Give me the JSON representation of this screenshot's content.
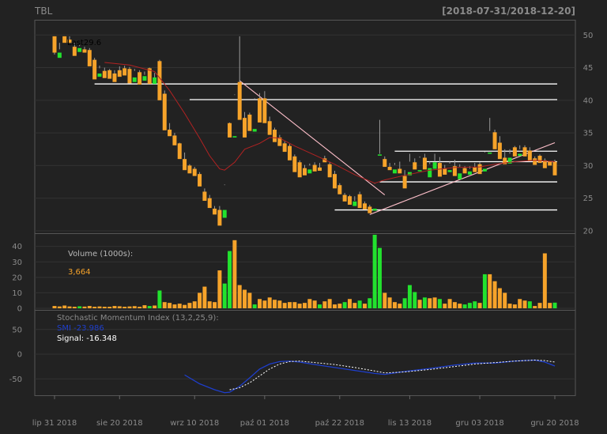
{
  "chart_data": {
    "type": "candlestick",
    "title": "TBL",
    "date_range": "[2018-07-31/2018-12-20]",
    "x_tick_labels": [
      "lip 31 2018",
      "sie 20 2018",
      "wrz 10 2018",
      "paź 01 2018",
      "paź 22 2018",
      "lis 13 2018",
      "gru 03 2018",
      "gru 20 2018"
    ],
    "price_ticks": [
      20,
      25,
      30,
      35,
      40,
      45,
      50
    ],
    "price_ylim": [
      20,
      51
    ],
    "last_label": "Last",
    "last_value": "29.6",
    "candles": [
      [
        49.8,
        49.8,
        47.3,
        47.0,
        "o"
      ],
      [
        47.3,
        48.8,
        46.5,
        47.8,
        "g"
      ],
      [
        49.8,
        49.8,
        48.8,
        49.3,
        "o"
      ],
      [
        49.3,
        49.8,
        48.8,
        49.3,
        "o"
      ],
      [
        48.2,
        48.8,
        46.8,
        47.5,
        "o"
      ],
      [
        48.0,
        48.5,
        47.4,
        48.3,
        "g"
      ],
      [
        47.8,
        48.2,
        47.3,
        47.3,
        "o"
      ],
      [
        47.7,
        48.0,
        45.2,
        45.6,
        "o"
      ],
      [
        46.2,
        46.5,
        43.2,
        44.0,
        "o"
      ],
      [
        44.1,
        45.3,
        43.6,
        44.9,
        "g"
      ],
      [
        44.5,
        45.0,
        43.4,
        43.6,
        "o"
      ],
      [
        44.6,
        44.8,
        43.3,
        43.6,
        "o"
      ],
      [
        44.1,
        44.6,
        42.8,
        43.4,
        "o"
      ],
      [
        44.6,
        45.2,
        43.6,
        44.3,
        "o"
      ],
      [
        44.9,
        45.3,
        43.8,
        44.1,
        "o"
      ],
      [
        44.8,
        45.1,
        42.6,
        43.3,
        "o"
      ],
      [
        43.5,
        44.8,
        42.8,
        44.5,
        "g"
      ],
      [
        44.3,
        44.6,
        42.4,
        43.1,
        "o"
      ],
      [
        43.7,
        44.4,
        43.0,
        43.9,
        "g"
      ],
      [
        44.9,
        45.0,
        42.5,
        42.9,
        "o"
      ],
      [
        43.5,
        44.2,
        42.5,
        42.8,
        "g"
      ],
      [
        46.0,
        46.2,
        40.0,
        42.2,
        "o"
      ],
      [
        41.0,
        41.5,
        35.4,
        36.3,
        "o"
      ],
      [
        35.5,
        36.5,
        34.5,
        35.0,
        "o"
      ],
      [
        34.6,
        35.0,
        33.1,
        33.3,
        "o"
      ],
      [
        33.4,
        33.5,
        31.0,
        31.5,
        "o"
      ],
      [
        31.0,
        32.0,
        29.3,
        29.6,
        "o"
      ],
      [
        30.0,
        30.2,
        28.8,
        29.1,
        "o"
      ],
      [
        29.5,
        29.8,
        28.4,
        28.8,
        "o"
      ],
      [
        28.7,
        29.0,
        26.8,
        27.2,
        "o"
      ],
      [
        26.0,
        26.5,
        24.6,
        25.0,
        "o"
      ],
      [
        25.0,
        25.5,
        23.5,
        23.8,
        "o"
      ],
      [
        23.4,
        23.8,
        22.5,
        22.8,
        "o"
      ],
      [
        23.2,
        23.8,
        20.8,
        21.3,
        "o"
      ],
      [
        23.2,
        27.1,
        22.0,
        27.0,
        "g"
      ],
      [
        36.5,
        36.6,
        34.3,
        34.4,
        "o"
      ],
      [
        34.5,
        40.9,
        34.3,
        40.8,
        "g"
      ],
      [
        42.8,
        49.8,
        37.0,
        37.3,
        "o"
      ],
      [
        37.3,
        38.2,
        34.3,
        34.6,
        "o"
      ],
      [
        37.8,
        38.1,
        35.3,
        35.6,
        "o"
      ],
      [
        35.6,
        40.3,
        35.2,
        40.2,
        "g"
      ],
      [
        40.3,
        41.1,
        36.6,
        36.8,
        "o"
      ],
      [
        40.3,
        41.4,
        36.5,
        36.8,
        "o"
      ],
      [
        36.8,
        37.5,
        34.7,
        35.1,
        "o"
      ],
      [
        35.5,
        35.8,
        33.6,
        33.9,
        "o"
      ],
      [
        34.3,
        34.7,
        33.0,
        33.4,
        "o"
      ],
      [
        33.4,
        33.7,
        32.1,
        32.6,
        "o"
      ],
      [
        33.0,
        33.3,
        30.8,
        31.5,
        "o"
      ],
      [
        31.4,
        31.7,
        29.0,
        29.3,
        "o"
      ],
      [
        30.5,
        30.8,
        28.2,
        28.6,
        "o"
      ],
      [
        29.6,
        30.1,
        28.5,
        29.0,
        "o"
      ],
      [
        29.4,
        30.3,
        28.8,
        30.0,
        "g"
      ],
      [
        30.1,
        30.5,
        29.1,
        29.5,
        "o"
      ],
      [
        29.7,
        30.4,
        29.2,
        29.6,
        "o"
      ],
      [
        31.1,
        31.5,
        30.5,
        30.6,
        "o"
      ],
      [
        30.2,
        30.6,
        28.2,
        28.7,
        "o"
      ],
      [
        28.7,
        29.2,
        26.5,
        27.0,
        "o"
      ],
      [
        27.0,
        27.3,
        25.6,
        26.0,
        "o"
      ],
      [
        25.5,
        25.8,
        24.5,
        24.8,
        "o"
      ],
      [
        25.3,
        25.5,
        24.0,
        24.3,
        "o"
      ],
      [
        24.5,
        25.3,
        23.8,
        24.6,
        "g"
      ],
      [
        25.6,
        26.0,
        23.5,
        24.0,
        "o"
      ],
      [
        24.2,
        24.5,
        23.3,
        23.6,
        "o"
      ],
      [
        23.7,
        24.0,
        22.7,
        23.1,
        "o"
      ],
      [
        23.4,
        27.3,
        23.1,
        27.2,
        "g"
      ],
      [
        31.7,
        37.0,
        31.6,
        31.8,
        "g"
      ],
      [
        31.0,
        31.4,
        29.8,
        30.0,
        "o"
      ],
      [
        29.8,
        30.4,
        29.3,
        29.6,
        "o"
      ],
      [
        29.4,
        30.4,
        28.8,
        30.1,
        "g"
      ],
      [
        29.5,
        30.6,
        28.8,
        28.9,
        "o"
      ],
      [
        28.4,
        29.3,
        26.5,
        27.6,
        "o"
      ],
      [
        29.0,
        31.8,
        28.5,
        30.6,
        "g"
      ],
      [
        30.5,
        31.1,
        29.4,
        29.5,
        "o"
      ],
      [
        29.3,
        31.4,
        29.1,
        31.2,
        "g"
      ],
      [
        31.2,
        31.8,
        29.4,
        29.6,
        "o"
      ],
      [
        29.6,
        30.6,
        28.2,
        30.2,
        "g"
      ],
      [
        30.5,
        31.8,
        29.5,
        30.6,
        "g"
      ],
      [
        30.4,
        31.3,
        28.3,
        29.2,
        "o"
      ],
      [
        29.5,
        30.1,
        28.6,
        29.4,
        "o"
      ],
      [
        29.3,
        30.6,
        29.0,
        30.3,
        "g"
      ],
      [
        29.9,
        30.9,
        28.4,
        28.8,
        "o"
      ],
      [
        28.8,
        30.2,
        27.9,
        29.8,
        "g"
      ],
      [
        29.6,
        29.9,
        28.8,
        29.1,
        "o"
      ],
      [
        29.1,
        29.9,
        28.6,
        29.5,
        "g"
      ],
      [
        29.7,
        30.4,
        29.0,
        29.8,
        "o"
      ],
      [
        30.2,
        30.5,
        28.7,
        29.4,
        "o"
      ],
      [
        29.5,
        32.1,
        29.1,
        32.0,
        "g"
      ],
      [
        32.0,
        37.3,
        31.8,
        35.3,
        "g"
      ],
      [
        35.1,
        35.5,
        32.5,
        32.8,
        "o"
      ],
      [
        33.5,
        34.5,
        31.0,
        31.2,
        "o"
      ],
      [
        31.2,
        32.5,
        30.2,
        31.0,
        "o"
      ],
      [
        31.2,
        32.5,
        30.3,
        31.8,
        "g"
      ],
      [
        32.8,
        33.0,
        31.4,
        31.8,
        "o"
      ],
      [
        31.8,
        33.1,
        31.5,
        32.5,
        "g"
      ],
      [
        32.8,
        33.1,
        31.4,
        31.6,
        "o"
      ],
      [
        32.3,
        32.8,
        30.7,
        31.1,
        "o"
      ],
      [
        31.1,
        31.4,
        30.1,
        30.2,
        "o"
      ],
      [
        31.5,
        31.7,
        30.4,
        30.7,
        "o"
      ],
      [
        30.8,
        31.1,
        29.6,
        30.1,
        "o"
      ],
      [
        30.6,
        30.7,
        30.0,
        30.2,
        "o"
      ],
      [
        30.6,
        30.9,
        28.5,
        29.6,
        "o"
      ]
    ],
    "sma_line": [
      [
        0,
        null
      ],
      [
        5,
        null
      ],
      [
        10,
        45.8
      ],
      [
        15,
        45.4
      ],
      [
        20,
        44.4
      ],
      [
        23,
        41.5
      ],
      [
        26,
        38.0
      ],
      [
        29,
        34.2
      ],
      [
        31,
        31.5
      ],
      [
        33,
        29.5
      ],
      [
        34,
        29.3
      ],
      [
        36,
        30.5
      ],
      [
        38,
        32.5
      ],
      [
        41,
        33.4
      ],
      [
        43,
        34.3
      ],
      [
        45,
        34.2
      ],
      [
        48,
        33.0
      ],
      [
        52,
        31.6
      ],
      [
        56,
        30.2
      ],
      [
        60,
        28.6
      ],
      [
        64,
        27.3
      ],
      [
        66,
        27.8
      ],
      [
        70,
        28.5
      ],
      [
        75,
        29.3
      ],
      [
        80,
        29.7
      ],
      [
        85,
        29.8
      ],
      [
        88,
        30.2
      ],
      [
        92,
        30.6
      ],
      [
        96,
        30.8
      ],
      [
        100,
        30.6
      ]
    ],
    "horizontal_levels": [
      {
        "y": 42.5,
        "from": 8,
        "to": 100
      },
      {
        "y": 40.1,
        "from": 27,
        "to": 100
      },
      {
        "y": 32.2,
        "from": 68,
        "to": 100
      },
      {
        "y": 30.6,
        "from": 74,
        "to": 100
      },
      {
        "y": 27.5,
        "from": 65,
        "to": 100
      },
      {
        "y": 23.2,
        "from": 56,
        "to": 100
      }
    ],
    "trend_lines": [
      {
        "x1": 37,
        "y1": 43.0,
        "x2": 66,
        "y2": 25.5
      },
      {
        "x1": 63,
        "y1": 22.5,
        "x2": 100,
        "y2": 33.5
      }
    ],
    "volume": {
      "label": "Volume (1000s):",
      "last": "3,664",
      "ticks": [
        0,
        10,
        20,
        30,
        40
      ],
      "ylim": [
        0,
        48
      ],
      "values": [
        1.5,
        1.2,
        1.8,
        1.2,
        1.0,
        1.3,
        1.1,
        1.5,
        1.0,
        1.2,
        1.0,
        1.0,
        1.5,
        1.3,
        1.0,
        1.2,
        1.4,
        1.0,
        2.0,
        1.5,
        1.8,
        11.5,
        4.0,
        3.5,
        2.5,
        3.0,
        2.2,
        3.5,
        4.5,
        10.0,
        14.0,
        4.5,
        4.0,
        24.5,
        16.0,
        37.0,
        44.0,
        15.0,
        12.0,
        10.0,
        2.5,
        6.0,
        5.0,
        7.0,
        5.5,
        5.0,
        3.5,
        4.0,
        4.0,
        3.0,
        3.5,
        6.0,
        5.0,
        2.5,
        4.5,
        6.0,
        2.5,
        3.0,
        4.0,
        6.0,
        3.5,
        5.0,
        3.0,
        6.5,
        47.5,
        39.0,
        10.0,
        7.0,
        4.0,
        3.0,
        6.5,
        15.0,
        10.5,
        5.5,
        7.0,
        6.5,
        7.0,
        6.0,
        3.0,
        6.0,
        4.0,
        3.0,
        2.5,
        3.5,
        4.5,
        3.5,
        22.0,
        22.0,
        17.5,
        13.0,
        10.0,
        3.0,
        2.5,
        6.0,
        5.0,
        4.5,
        1.5,
        3.5,
        35.5,
        3.5,
        3.66
      ],
      "colors": "ooooogooooooooooooogogooooooooooooggoooogoooooooooooogoooogoogogggoooogggogoogoooogggogoooooooogoooog"
    },
    "smi": {
      "label": "Stochastic Momentum Index (13,2,25,9):",
      "smi_label": "SMI",
      "smi_value": "-23.986",
      "signal_label": "Signal:",
      "signal_value": "-16.348",
      "ticks": [
        50,
        0,
        -50
      ],
      "ylim": [
        -88,
        88
      ],
      "smi_points": [
        [
          26,
          -42
        ],
        [
          29,
          -60
        ],
        [
          32,
          -72
        ],
        [
          34,
          -78
        ],
        [
          35,
          -77
        ],
        [
          37,
          -65
        ],
        [
          39,
          -48
        ],
        [
          41,
          -30
        ],
        [
          43,
          -20
        ],
        [
          45,
          -15
        ],
        [
          47,
          -14
        ],
        [
          49,
          -16
        ],
        [
          52,
          -21
        ],
        [
          56,
          -27
        ],
        [
          60,
          -33
        ],
        [
          64,
          -39
        ],
        [
          66,
          -41
        ],
        [
          70,
          -35
        ],
        [
          75,
          -29
        ],
        [
          80,
          -22
        ],
        [
          84,
          -18
        ],
        [
          88,
          -18
        ],
        [
          92,
          -14
        ],
        [
          96,
          -12
        ],
        [
          98,
          -16
        ],
        [
          100,
          -24
        ]
      ],
      "signal_points": [
        [
          35,
          -72
        ],
        [
          37,
          -68
        ],
        [
          39,
          -58
        ],
        [
          41,
          -44
        ],
        [
          43,
          -30
        ],
        [
          45,
          -20
        ],
        [
          47,
          -15
        ],
        [
          49,
          -14
        ],
        [
          52,
          -17
        ],
        [
          56,
          -21
        ],
        [
          60,
          -27
        ],
        [
          64,
          -34
        ],
        [
          66,
          -38
        ],
        [
          70,
          -36
        ],
        [
          75,
          -31
        ],
        [
          80,
          -25
        ],
        [
          84,
          -20
        ],
        [
          88,
          -17
        ],
        [
          92,
          -14
        ],
        [
          96,
          -12
        ],
        [
          98,
          -13
        ],
        [
          100,
          -16
        ]
      ]
    },
    "colors": {
      "up": "#22e22e",
      "down": "#f6a32a",
      "sma": "#b22222",
      "level": "#ffffff",
      "trend": "#ffc0cb",
      "smi": "#1e3ecc",
      "signal": "#ffffff",
      "text": "#8a8a8a",
      "volume_label": "#b8b8b8",
      "volume_value": "#f6a32a",
      "smi_value": "#1e3ecc",
      "signal_text": "#ffffff"
    }
  }
}
